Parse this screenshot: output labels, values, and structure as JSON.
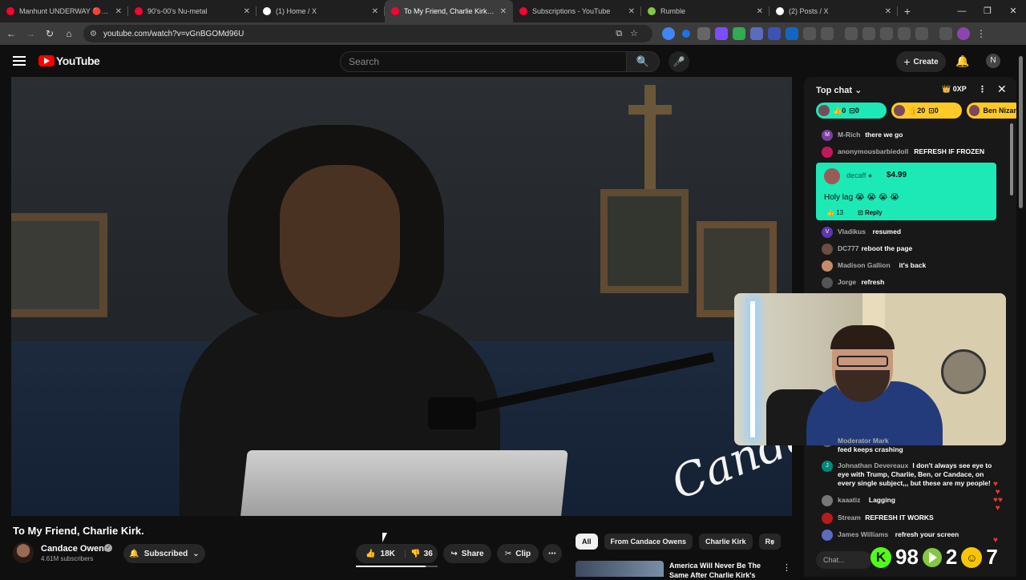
{
  "browser": {
    "tabs": [
      {
        "title": "Manhunt UNDERWAY 🔴 RIP",
        "color": "#ff0033",
        "active": false
      },
      {
        "title": "90's-00's Nu-metal",
        "color": "#ff0033",
        "active": false
      },
      {
        "title": "(1) Home / X",
        "color": "#ffffff",
        "active": false
      },
      {
        "title": "To My Friend, Charlie Kirk. - You",
        "color": "#ff0033",
        "active": true
      },
      {
        "title": "Subscriptions - YouTube",
        "color": "#ff0033",
        "active": false
      },
      {
        "title": "Rumble",
        "color": "#85c742",
        "active": false
      },
      {
        "title": "(2) Posts / X",
        "color": "#ffffff",
        "active": false
      }
    ],
    "url": "youtube.com/watch?v=vGnBGOMd96U"
  },
  "header": {
    "logo": "YouTube",
    "search_placeholder": "Search",
    "create_label": "Create",
    "account_initial": "N"
  },
  "video": {
    "title": "To My Friend, Charlie Kirk.",
    "signature": "Candace",
    "channel_name": "Candace Owens",
    "subscribers": "4.61M subscribers",
    "subscribed_label": "Subscribed",
    "likes": "18K",
    "dislikes": "36",
    "like_ratio": 0.85,
    "share_label": "Share",
    "clip_label": "Clip"
  },
  "related": {
    "chips": [
      "All",
      "From Candace Owens",
      "Charlie Kirk",
      "Re"
    ],
    "first_title": "America Will Never Be The Same After Charlie Kirk's"
  },
  "chat": {
    "title": "Top chat",
    "xp": "0XP",
    "tickers": [
      {
        "likes": "0",
        "replies": "0",
        "color": "#1de9b6"
      },
      {
        "likes": "20",
        "replies": "0",
        "color": "#ffca28"
      },
      {
        "name": "Ben Nizar",
        "color": "#ffca28"
      }
    ],
    "messages": [
      {
        "name": "M-Rich",
        "text": "there we go",
        "initial": "M",
        "color": "#7b3fa0"
      },
      {
        "name": "anonymousbarbiedoll",
        "text": "REFRESH IF FROZEN",
        "initial": "",
        "color": "#c2185b"
      },
      {
        "name": "Vladikus",
        "text": "resumed",
        "initial": "V",
        "color": "#5e35b1"
      },
      {
        "name": "DC777",
        "text": "reboot the page",
        "initial": "",
        "color": "#6d4c41"
      },
      {
        "name": "Madison Gallion",
        "text": "it's back",
        "initial": "",
        "color": "#c98a6a"
      },
      {
        "name": "Jorge",
        "text": "refresh",
        "initial": "",
        "color": "#555555"
      },
      {
        "name": "Moderator Mark",
        "text": "too many people are here ... the feed keeps crashing",
        "initial": "",
        "color": "#666666"
      },
      {
        "name": "Johnathan Devereaux",
        "text": "I don't always see eye to eye with Trump, Charlie, Ben, or Candace, on every single subject,,, but these are my people!",
        "initial": "J",
        "color": "#00897b"
      },
      {
        "name": "kaaatiz",
        "text": "Lagging",
        "initial": "",
        "color": "#777777"
      },
      {
        "name": "Stream",
        "text": "REFRESH IT WORKS",
        "initial": "",
        "color": "#b71c1c"
      },
      {
        "name": "James Williams",
        "text": "refresh your screen",
        "initial": "",
        "color": "#5c6bc0"
      }
    ],
    "superchat": {
      "name": "decaff",
      "amount": "$4.99",
      "text": "Holy lag 😭 😭 😭 😭",
      "likes": "13",
      "reply_label": "Reply"
    },
    "input_placeholder": "Chat...",
    "overlay": {
      "kick_count": "98",
      "rumble_count": "2",
      "extra_count": "7"
    }
  }
}
